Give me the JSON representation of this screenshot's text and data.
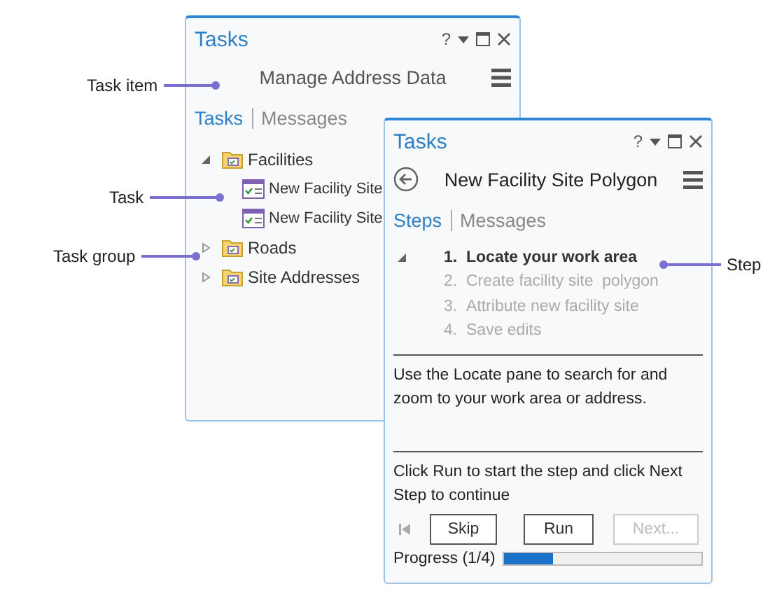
{
  "callouts": [
    {
      "text": "Task item"
    },
    {
      "text": "Task"
    },
    {
      "text": "Task group"
    },
    {
      "text": "Step"
    }
  ],
  "task_pane": {
    "title": "Tasks",
    "help": "?",
    "task_item": "Manage Address Data",
    "tabs": [
      {
        "label": "Tasks",
        "selected": true
      },
      {
        "label": "Messages",
        "selected": false
      }
    ],
    "tree": [
      {
        "label": "Facilities",
        "kind": "group",
        "expanded": true,
        "children": [
          {
            "label": "New Facility Site",
            "kind": "task"
          },
          {
            "label": "New Facility Site",
            "kind": "task"
          }
        ]
      },
      {
        "label": "Roads",
        "kind": "group",
        "expanded": false
      },
      {
        "label": "Site Addresses",
        "kind": "group",
        "expanded": false
      }
    ]
  },
  "step_pane": {
    "title": "Tasks",
    "help": "?",
    "task": "New Facility Site Polygon",
    "tabs": [
      {
        "label": "Steps",
        "selected": true
      },
      {
        "label": "Messages",
        "selected": false
      }
    ],
    "steps_expanded": true,
    "steps": [
      {
        "number": "1.",
        "label": "Locate your work area",
        "selected": true
      },
      {
        "number": "2.",
        "label": "Create facility site  polygon",
        "selected": false
      },
      {
        "number": "3.",
        "label": "Attribute new facility site",
        "selected": false
      },
      {
        "number": "4.",
        "label": "Save edits",
        "selected": false
      }
    ],
    "instructions": "Use the Locate pane to search for and zoom to your work area or address.",
    "prompt": "Click Run to start the step and click Next Step to continue",
    "buttons": [
      {
        "label": "Skip",
        "disabled": false
      },
      {
        "label": "Run",
        "disabled": false
      },
      {
        "label": "Next...",
        "disabled": true
      }
    ],
    "progress": {
      "label": "Progress (1/4)",
      "level": 0.25
    }
  }
}
